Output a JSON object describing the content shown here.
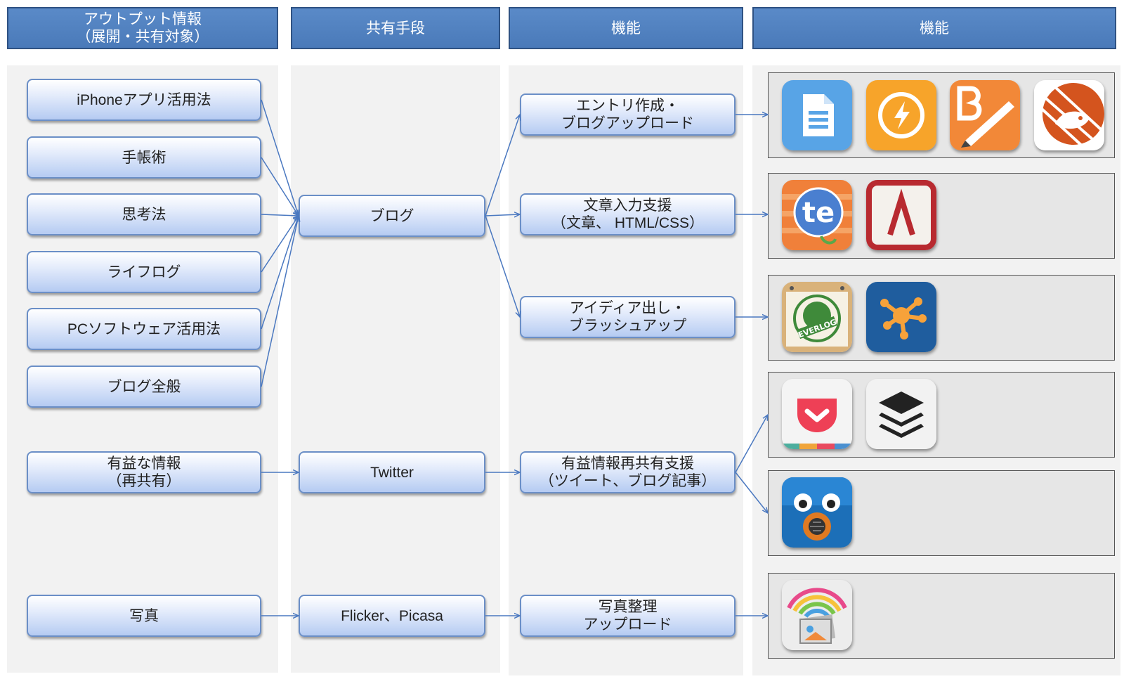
{
  "headers": {
    "output": "アウトプット情報\n（展開・共有対象）",
    "share": "共有手段",
    "function": "機能",
    "function2": "機能"
  },
  "outputs": {
    "iphone": "iPhoneアプリ活用法",
    "techo": "手帳術",
    "shiko": "思考法",
    "lifelog": "ライフログ",
    "pc": "PCソフトウェア活用法",
    "blog_general": "ブログ全般",
    "useful": "有益な情報\n（再共有）",
    "photo": "写真"
  },
  "shares": {
    "blog": "ブログ",
    "twitter": "Twitter",
    "flicker": "Flicker、Picasa"
  },
  "functions": {
    "entry": "エントリ作成・\nブログアップロード",
    "text": "文章入力支援\n（文章、 HTML/CSS）",
    "idea": "アイディア出し・\nブラッシュアップ",
    "reshare": "有益情報再共有支援\n（ツイート、ブログ記事）",
    "photo": "写真整理\nアップロード"
  },
  "icons": {
    "everlog_label": "EVERLOG"
  },
  "colors": {
    "header": "#4a7ab9",
    "node_border": "#6b8fc7",
    "arrow": "#4a78c0"
  }
}
